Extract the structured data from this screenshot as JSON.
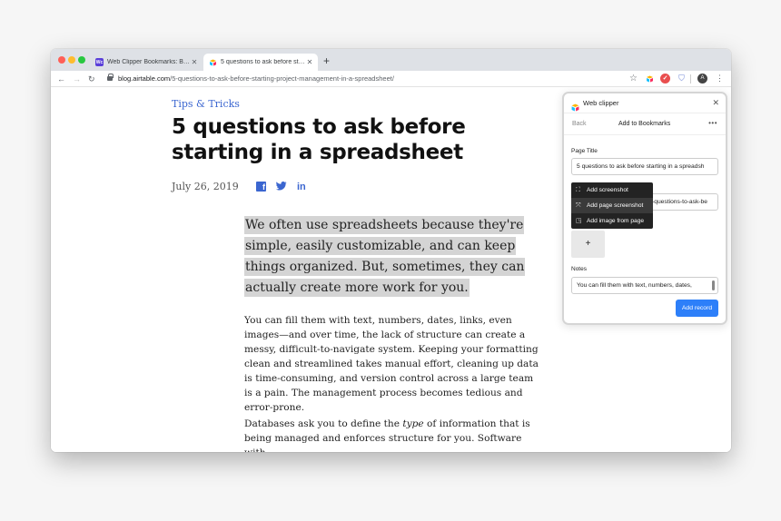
{
  "browser": {
    "tabs": [
      {
        "title": "Web Clipper Bookmarks: Bookm",
        "favicon": "webclipper-favicon",
        "active": false
      },
      {
        "title": "5 questions to ask before starti",
        "favicon": "airtable-favicon",
        "active": true
      }
    ],
    "new_tab": "+",
    "url_host": "blog.airtable.com",
    "url_path": "/5-questions-to-ask-before-starting-project-management-in-a-spreadsheet/",
    "avatar_initial": "A"
  },
  "article": {
    "kicker": "Tips & Tricks",
    "headline": "5 questions to ask before starting in a spreadsheet",
    "date": "July 26, 2019",
    "lede": "We often use spreadsheets because they're simple, easily customizable, and can keep things organized. But, sometimes, they can actually create more work for you.",
    "para1": "You can fill them with text, numbers, dates, links, even images—and over time, the lack of structure can create a messy, difficult-to-navigate system. Keeping your formatting clean and streamlined takes manual effort, cleaning up data is time-consuming, and version control across a large team is a pain. The management process becomes tedious and error-prone.",
    "para2_before": "Databases ask you to define the ",
    "para2_em": "type",
    "para2_after": " of information that is being managed and enforces structure for you. Software with"
  },
  "clipper": {
    "title": "Web clipper",
    "back": "Back",
    "nav_title": "Add to Bookmarks",
    "more": "•••",
    "page_title_label": "Page Title",
    "page_title_value": "5 questions to ask before starting in a spreadsh",
    "url_value": "-questions-to-ask-be",
    "attach_label": "+",
    "menu": [
      {
        "label": "Add screenshot",
        "icon": "crop-icon"
      },
      {
        "label": "Add page screenshot",
        "icon": "expand-icon"
      },
      {
        "label": "Add image from page",
        "icon": "image-icon"
      }
    ],
    "notes_label": "Notes",
    "notes_value": "You can fill them with text, numbers, dates,",
    "add_record": "Add record"
  },
  "colors": {
    "accent_blue": "#3b66d0",
    "button_blue": "#2d7ff9",
    "highlight": "#d4d4d4"
  }
}
